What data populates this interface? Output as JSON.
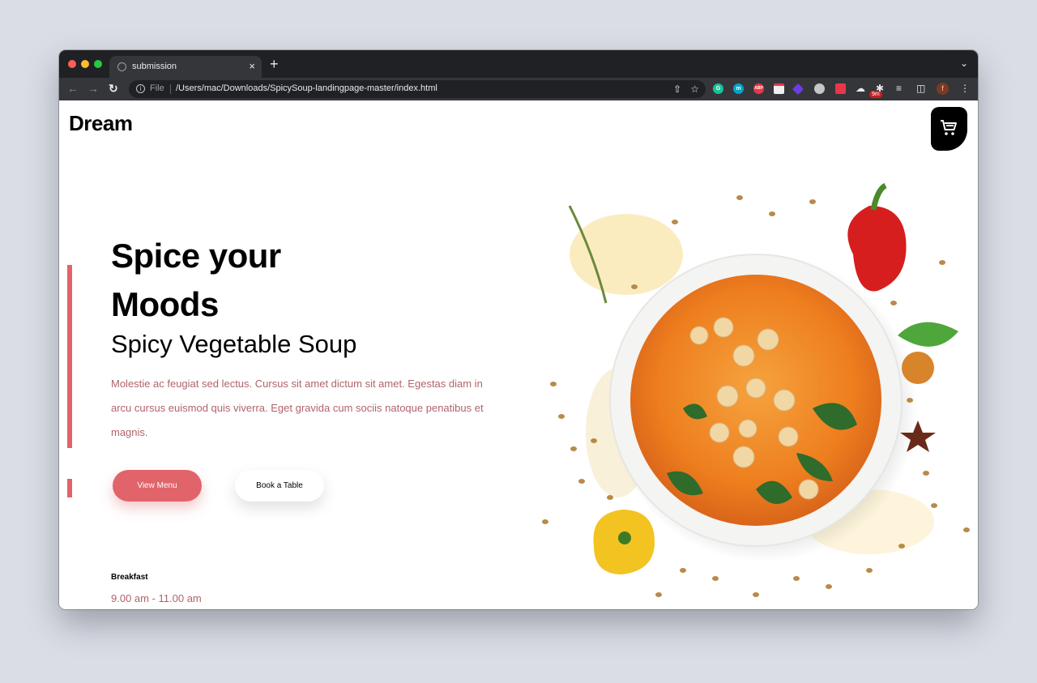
{
  "browser": {
    "tab_title": "submission",
    "new_tab": "+",
    "tab_close": "×",
    "file_label": "File",
    "url": "/Users/mac/Downloads/SpicySoup-landingpage-master/index.html",
    "extensions": [
      {
        "name": "grammarly-extension-icon",
        "text": "G",
        "color": "#15c39a"
      },
      {
        "name": "m-extension-icon",
        "text": "m",
        "color": "#00a6c8"
      },
      {
        "name": "adblock-plus-extension-icon",
        "text": "ABP",
        "color": "#e8374a"
      },
      {
        "name": "notes-extension-icon",
        "text": "",
        "color": "#f0f0f0"
      },
      {
        "name": "purple-extension-icon",
        "text": "",
        "color": "#6a3de8"
      },
      {
        "name": "globe-extension-icon",
        "text": "",
        "color": "#c4c7c5"
      },
      {
        "name": "red-extension-icon",
        "text": "",
        "color": "#e8374a"
      }
    ],
    "badge": "9m",
    "profile_initial": "f"
  },
  "page": {
    "logo": "Dream",
    "headline_line1": "Spice your",
    "headline_line2": "Moods",
    "subheading": "Spicy Vegetable Soup",
    "description": "Molestie ac feugiat sed lectus. Cursus sit amet dictum sit amet. Egestas diam in arcu cursus euismod quis viverra. Eget gravida cum sociis natoque penatibus et magnis.",
    "primary_button": "View Menu",
    "secondary_button": "Book a Table",
    "hours_label": "Breakfast",
    "hours_value": "9.00 am - 11.00 am",
    "colors": {
      "accent": "#e0646a",
      "text_muted": "#b0636a",
      "soup": "#f08a2a"
    }
  }
}
